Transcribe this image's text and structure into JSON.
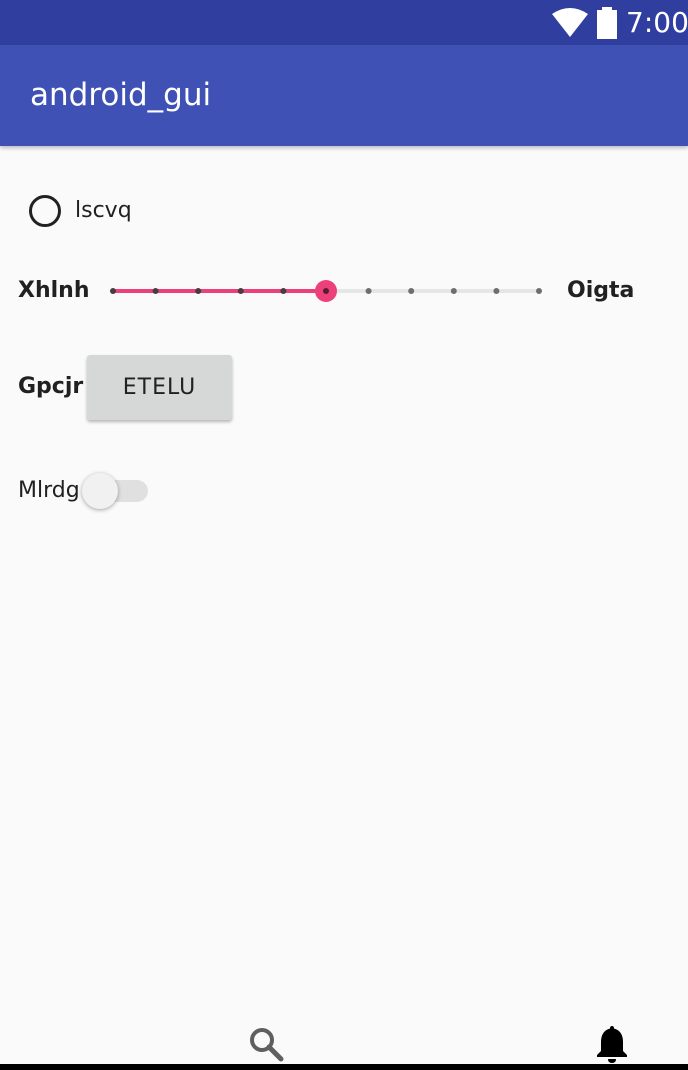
{
  "status_bar": {
    "time": "7:00",
    "icons": [
      "wifi-icon",
      "battery-icon"
    ]
  },
  "app_bar": {
    "title": "android_gui"
  },
  "radio": {
    "label": "lscvq",
    "checked": false
  },
  "slider": {
    "left_label": "Xhlnh",
    "right_label": "Oigta",
    "steps": 10,
    "value_step": 5,
    "accent": "#ec407a"
  },
  "button_row": {
    "label": "Gpcjr",
    "button_text": "ETELU"
  },
  "switch_row": {
    "label": "Mlrdg",
    "on": false
  },
  "bottom_nav": {
    "icons": [
      "search-icon",
      "bell-icon"
    ]
  },
  "colors": {
    "status_bar": "#303f9f",
    "app_bar": "#3f51b5",
    "accent": "#ec407a",
    "background": "#fafafa"
  }
}
